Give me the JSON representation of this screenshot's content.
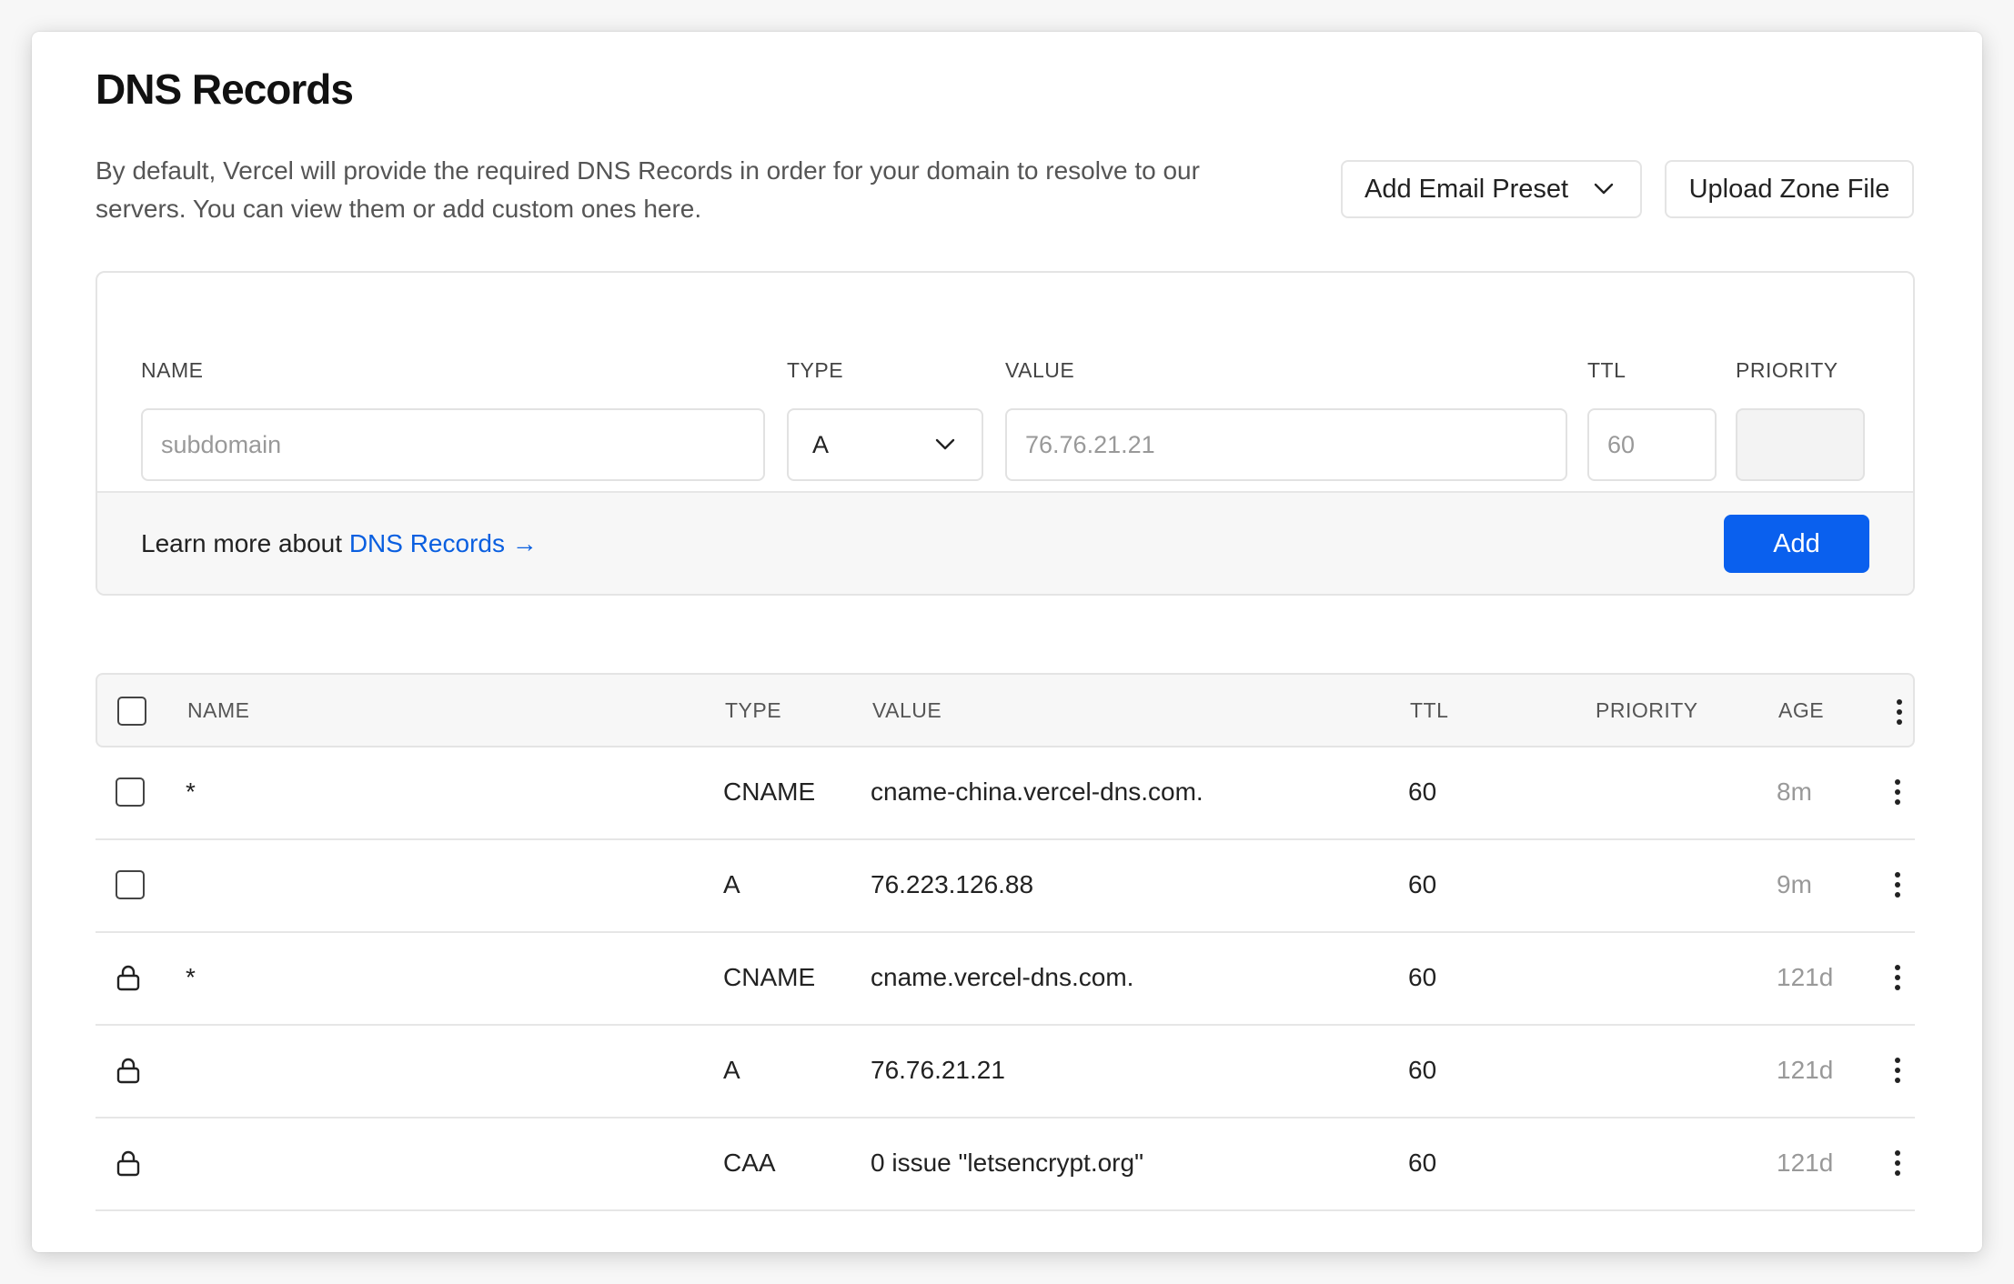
{
  "page": {
    "title": "DNS Records",
    "description": "By default, Vercel will provide the required DNS Records in order for your domain to resolve to our servers. You can view them or add custom ones here."
  },
  "actions": {
    "email_preset_label": "Add Email Preset",
    "upload_label": "Upload Zone File"
  },
  "form": {
    "labels": {
      "name": "NAME",
      "type": "TYPE",
      "value": "VALUE",
      "ttl": "TTL",
      "priority": "PRIORITY"
    },
    "name_placeholder": "subdomain",
    "type_selected": "A",
    "value_placeholder": "76.76.21.21",
    "ttl_placeholder": "60",
    "priority_value": "",
    "learn_text": "Learn more about ",
    "learn_link": "DNS Records →",
    "add_label": "Add"
  },
  "table": {
    "headers": {
      "name": "NAME",
      "type": "TYPE",
      "value": "VALUE",
      "ttl": "TTL",
      "priority": "PRIORITY",
      "age": "AGE"
    },
    "rows": [
      {
        "locked": false,
        "name": "*",
        "type": "CNAME",
        "value": "cname-china.vercel-dns.com.",
        "ttl": "60",
        "priority": "",
        "age": "8m"
      },
      {
        "locked": false,
        "name": "",
        "type": "A",
        "value": "76.223.126.88",
        "ttl": "60",
        "priority": "",
        "age": "9m"
      },
      {
        "locked": true,
        "name": "*",
        "type": "CNAME",
        "value": "cname.vercel-dns.com.",
        "ttl": "60",
        "priority": "",
        "age": "121d"
      },
      {
        "locked": true,
        "name": "",
        "type": "A",
        "value": "76.76.21.21",
        "ttl": "60",
        "priority": "",
        "age": "121d"
      },
      {
        "locked": true,
        "name": "",
        "type": "CAA",
        "value": "0 issue \"letsencrypt.org\"",
        "ttl": "60",
        "priority": "",
        "age": "121d"
      }
    ]
  },
  "colors": {
    "accent": "#0a60ee",
    "link": "#0a5fe0"
  }
}
